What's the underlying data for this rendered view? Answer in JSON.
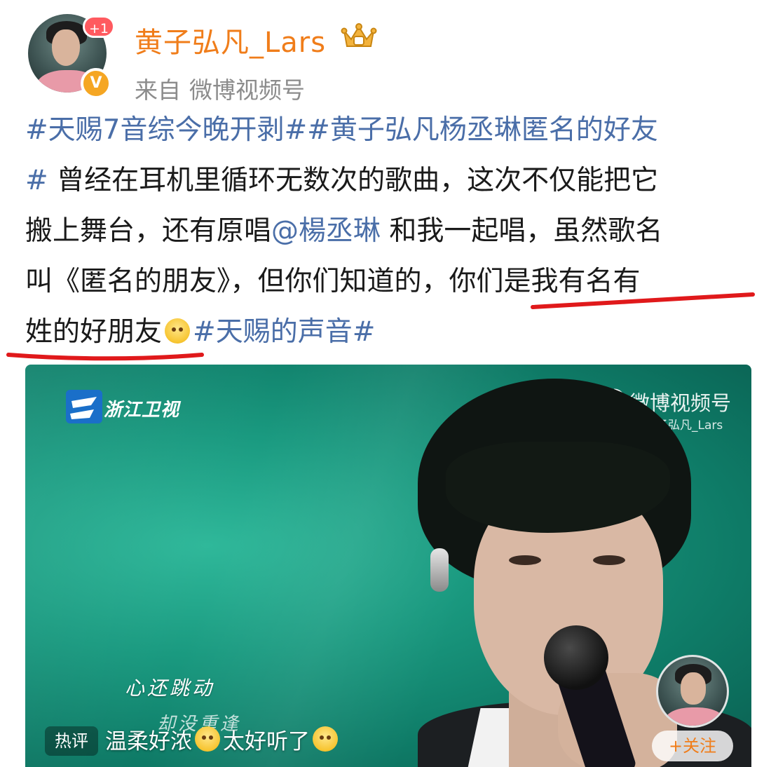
{
  "header": {
    "username": "黄子弘凡_Lars",
    "new_post_badge": "+1",
    "verified_mark": "V",
    "source_prefix": "来自",
    "source_name": "微博视频号"
  },
  "post": {
    "lines": [
      [
        {
          "t": "#天赐7音综今晚开剥##黄子弘凡杨丞琳匿名的好友",
          "k": "topic"
        }
      ],
      [
        {
          "t": "#",
          "k": "topic"
        },
        {
          "t": " 曾经在耳机里循环无数次的歌曲，这次不仅能把它",
          "k": "text"
        }
      ],
      [
        {
          "t": "搬上舞台，还有原唱",
          "k": "text"
        },
        {
          "t": "@楊丞琳",
          "k": "mention"
        },
        {
          "t": " 和我一起唱，虽然歌名",
          "k": "text"
        }
      ],
      [
        {
          "t": "叫《匿名的朋友》，但你们知道的，你们是我有名有",
          "k": "text"
        }
      ],
      [
        {
          "t": "姓的好朋友",
          "k": "text"
        },
        {
          "t": "",
          "k": "emoji"
        },
        {
          "t": "#天赐的声音#",
          "k": "topic"
        }
      ]
    ]
  },
  "video": {
    "channel_name": "浙江卫视",
    "watermark_title": "微博视频号",
    "watermark_handle": "@黄子弘凡_Lars",
    "lyric_current": "心还跳动",
    "lyric_next": "却没重逢",
    "hot_comment_tag": "热评",
    "hot_comment_text_1": "温柔好浓",
    "hot_comment_text_2": "太好听了",
    "follow_label": "+关注"
  },
  "colors": {
    "username": "#f07d1a",
    "topic_link": "#4a6ea8",
    "underline_annotation": "#e0191b",
    "video_bg": "#1a9a80"
  }
}
